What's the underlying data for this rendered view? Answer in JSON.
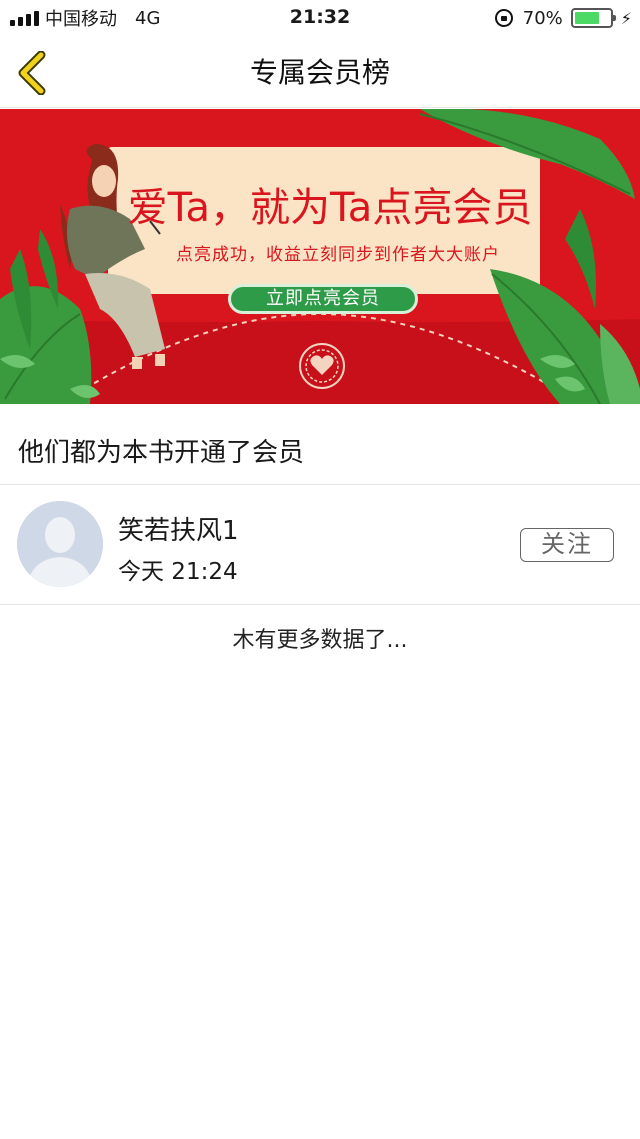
{
  "status_bar": {
    "carrier": "中国移动",
    "network": "4G",
    "time": "21:32",
    "battery": "70%",
    "battery_level": 0.7
  },
  "nav": {
    "title": "专属会员榜",
    "back_icon": "chevron-left-icon",
    "back_color": "#e8c400"
  },
  "banner": {
    "title": "爱Ta，就为Ta点亮会员",
    "subtitle": "点亮成功，收益立刻同步到作者大大账户",
    "button_label": "立即点亮会员",
    "background_color": "#d9161d",
    "button_color": "#2e9b48"
  },
  "section": {
    "title": "他们都为本书开通了会员"
  },
  "members": [
    {
      "name": "笑若扶风1",
      "time": "今天 21:24",
      "follow_label": "关注",
      "avatar_icon": "default-avatar-icon"
    }
  ],
  "footer": {
    "no_more_text": "木有更多数据了..."
  }
}
